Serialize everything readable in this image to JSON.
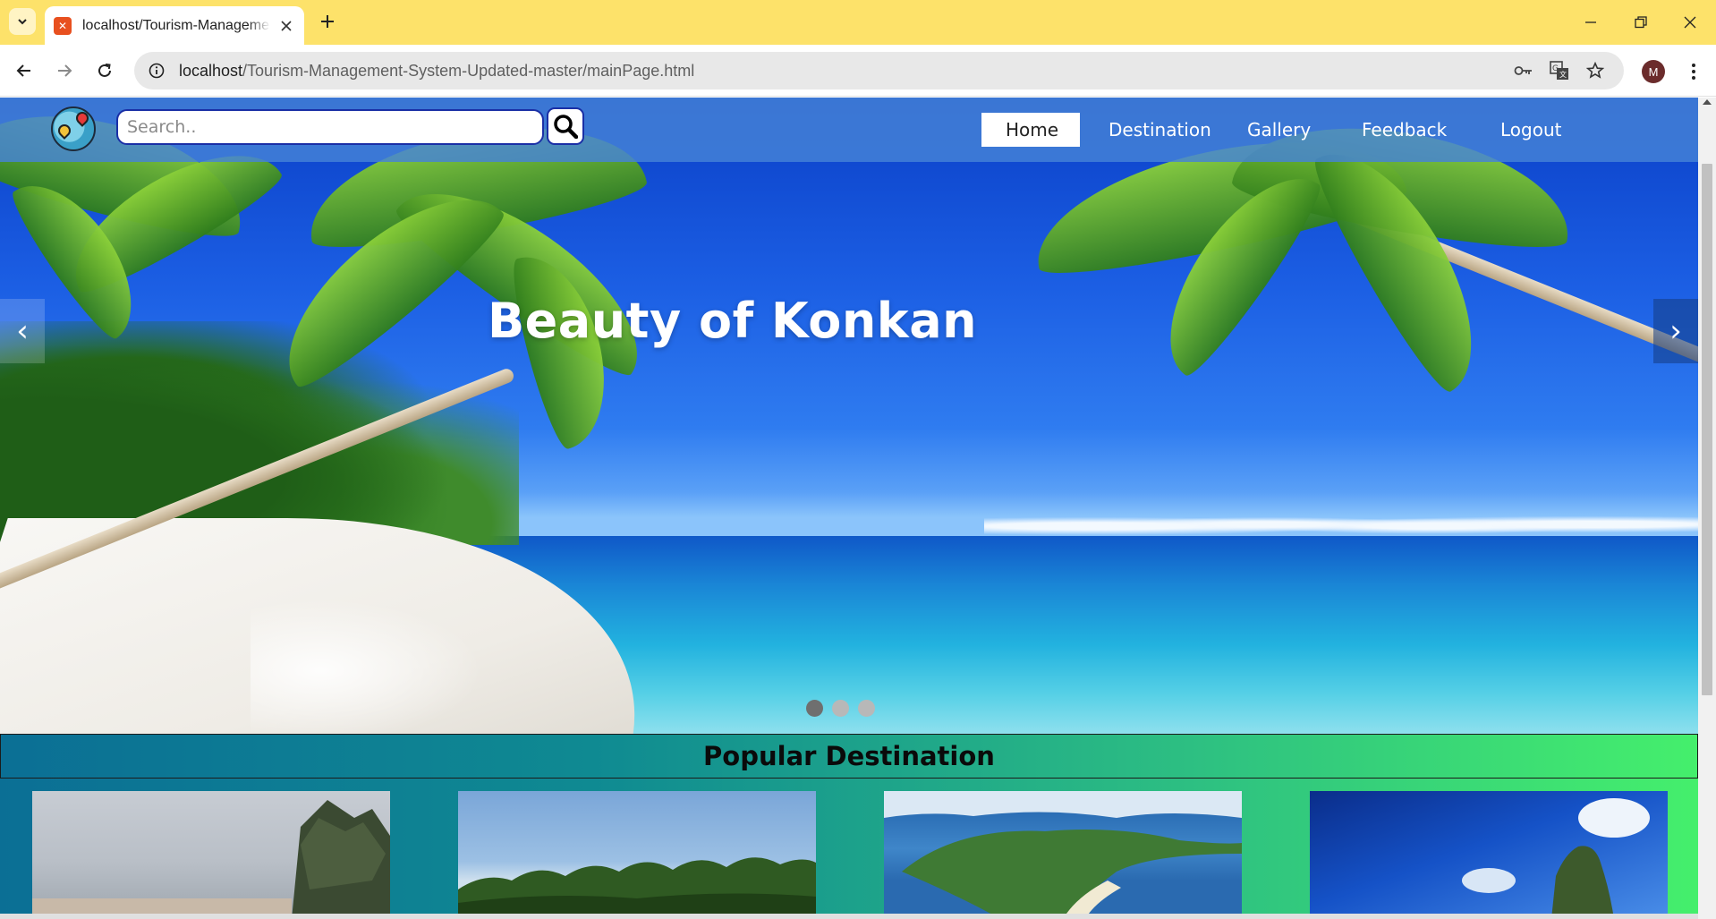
{
  "browser": {
    "tab_title": "localhost/Tourism-Management-System-Updated-master/mainPage.html",
    "url_host": "localhost",
    "url_path": "/Tourism-Management-System-Updated-master/mainPage.html",
    "profile_initial": "M",
    "icons": {
      "tab_search": "chevron-down-icon",
      "close_tab": "close-icon",
      "new_tab": "plus-icon",
      "minimize": "minimize-icon",
      "restore": "restore-icon",
      "close_window": "close-icon",
      "back": "arrow-left-icon",
      "forward": "arrow-right-icon",
      "reload": "reload-icon",
      "site_info": "info-icon",
      "passwords": "key-icon",
      "translate": "translate-icon",
      "bookmark": "star-icon",
      "menu": "more-vertical-icon"
    }
  },
  "header": {
    "search_placeholder": "Search..",
    "search_icon": "search-icon",
    "nav": [
      {
        "label": "Home",
        "active": true
      },
      {
        "label": "Destination",
        "active": false
      },
      {
        "label": "Gallery",
        "active": false
      },
      {
        "label": "Feedback",
        "active": false
      },
      {
        "label": "Logout",
        "active": false
      }
    ]
  },
  "hero": {
    "title": "Beauty of Konkan",
    "prev_label": "‹",
    "next_label": "›",
    "slide_count": 3,
    "active_slide": 1
  },
  "popular": {
    "title": "Popular Destination",
    "cards": 4
  },
  "colors": {
    "tabbar": "#fde26a",
    "header_overlay": "#4582d7",
    "search_border": "#1a2fa6",
    "popular_gradient_start": "#0b6f95",
    "popular_gradient_end": "#45ef6c"
  }
}
